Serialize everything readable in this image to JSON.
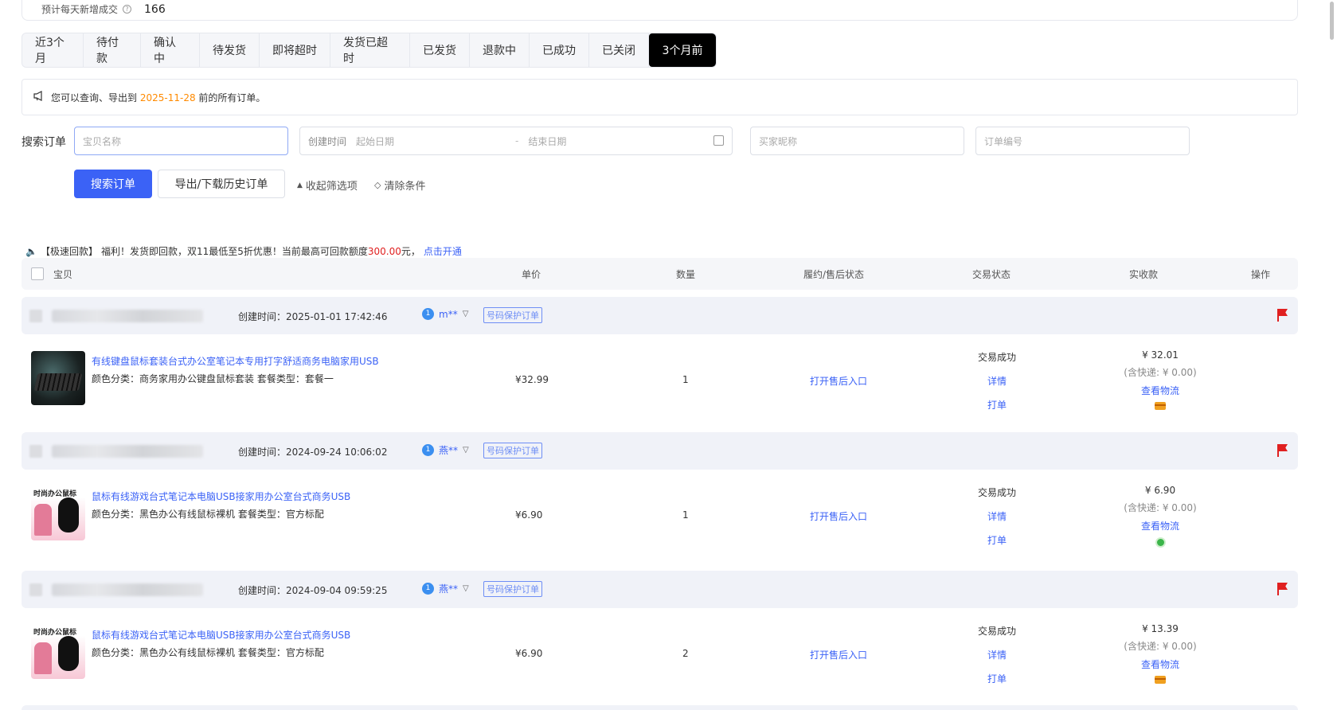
{
  "stats": {
    "estimate_label": "预计每天新增成交",
    "estimate_value": "166"
  },
  "tabs": [
    {
      "label": "近3个月"
    },
    {
      "label": "待付款"
    },
    {
      "label": "确认中"
    },
    {
      "label": "待发货"
    },
    {
      "label": "即将超时"
    },
    {
      "label": "发货已超时"
    },
    {
      "label": "已发货"
    },
    {
      "label": "退款中"
    },
    {
      "label": "已成功"
    },
    {
      "label": "已关闭"
    },
    {
      "label": "3个月前"
    }
  ],
  "active_tab": "3个月前",
  "notice": {
    "prefix": "您可以查询、导出到",
    "date": "2025-11-28",
    "suffix": "前的所有订单。"
  },
  "search": {
    "label": "搜索订单",
    "item_placeholder": "宝贝名称",
    "created_label": "创建时间",
    "start_placeholder": "起始日期",
    "range_sep": "-",
    "end_placeholder": "结束日期",
    "buyer_placeholder": "买家昵称",
    "order_placeholder": "订单编号",
    "search_button": "搜索订单",
    "export_button": "导出/下载历史订单",
    "collapse_link": "收起筛选项",
    "clear_link": "清除条件"
  },
  "promo": {
    "tag": "【极速回款】",
    "text": "福利！发货即回款，双11最低至5折优惠！当前最高可回款额度",
    "amount": "300.00",
    "unit": "元，",
    "link": "点击开通"
  },
  "table_header": {
    "item": "宝贝",
    "unit_price": "单价",
    "quantity": "数量",
    "fulfillment": "履约/售后状态",
    "trade_status": "交易状态",
    "paid": "实收款",
    "action": "操作"
  },
  "orders": [
    {
      "created": "创建时间：2025-01-01 17:42:46",
      "buyer": "m**",
      "protect_tag": "号码保护订单",
      "title": "有线键盘鼠标套装台式办公室笔记本专用打字舒适商务电脑家用USB",
      "sku": "颜色分类：商务家用办公键盘鼠标套装   套餐类型：套餐一",
      "price": "¥32.99",
      "qty": "1",
      "after_sale": "打开售后入口",
      "status": "交易成功",
      "detail": "详情",
      "print": "打单",
      "paid": "¥ 32.01",
      "shipping": "(含快递: ¥ 0.00)",
      "logistics": "查看物流",
      "icon": "card-icon"
    },
    {
      "created": "创建时间：2024-09-24 10:06:02",
      "buyer": "燕**",
      "protect_tag": "号码保护订单",
      "title": "鼠标有线游戏台式笔记本电脑USB接家用办公室台式商务USB",
      "sku": "颜色分类：黑色办公有线鼠标裸机   套餐类型：官方标配",
      "price": "¥6.90",
      "qty": "1",
      "after_sale": "打开售后入口",
      "status": "交易成功",
      "detail": "详情",
      "print": "打单",
      "paid": "¥ 6.90",
      "shipping": "(含快递: ¥ 0.00)",
      "logistics": "查看物流",
      "icon": "green-icon"
    },
    {
      "created": "创建时间：2024-09-04 09:59:25",
      "buyer": "燕**",
      "protect_tag": "号码保护订单",
      "title": "鼠标有线游戏台式笔记本电脑USB接家用办公室台式商务USB",
      "sku": "颜色分类：黑色办公有线鼠标裸机   套餐类型：官方标配",
      "price": "¥6.90",
      "qty": "2",
      "after_sale": "打开售后入口",
      "status": "交易成功",
      "detail": "详情",
      "print": "打单",
      "paid": "¥ 13.39",
      "shipping": "(含快递: ¥ 0.00)",
      "logistics": "查看物流",
      "icon": "card-icon"
    }
  ],
  "thumb_text": {
    "mouse_brand": "时尚办公鼠标"
  }
}
